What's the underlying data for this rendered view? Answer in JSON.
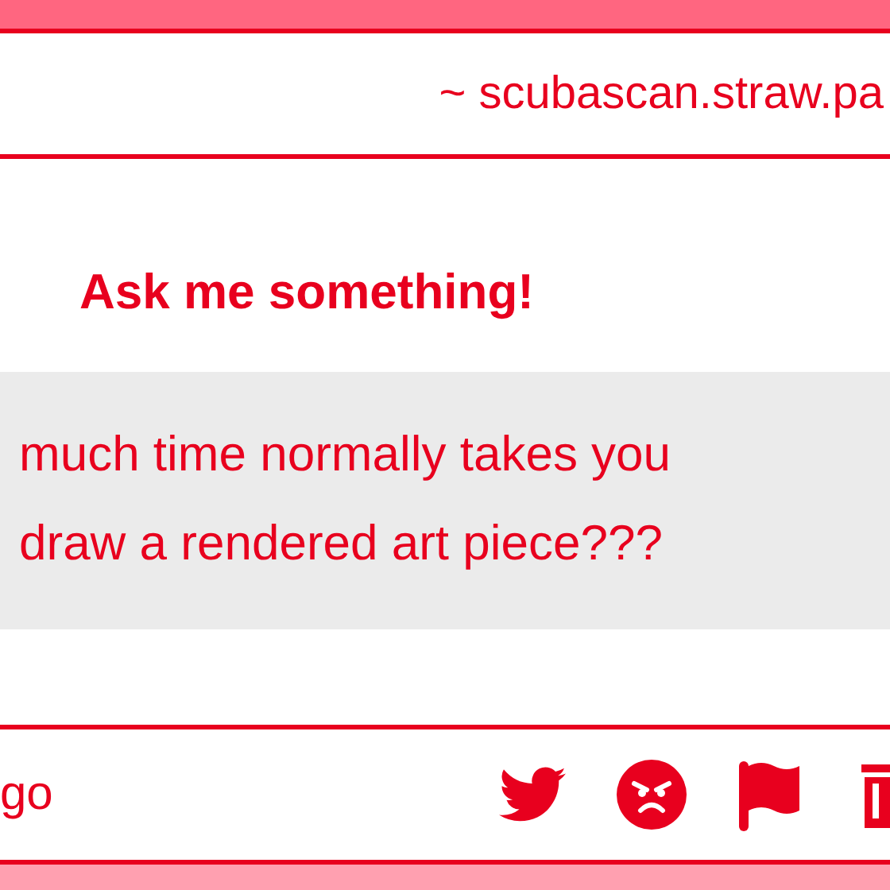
{
  "header": {
    "url": "~ scubascan.straw.pa"
  },
  "title": "Ask me something!",
  "question": {
    "lines": [
      "much time normally takes you",
      "draw a rendered art piece???"
    ]
  },
  "footer": {
    "time": "go"
  }
}
